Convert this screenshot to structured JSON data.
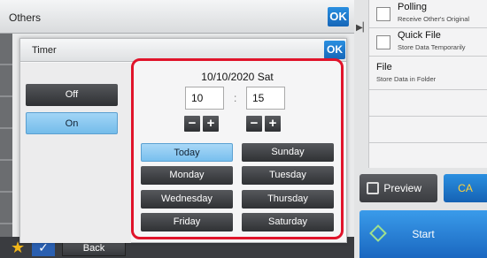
{
  "screen": {
    "title": "Others",
    "ok_label": "OK"
  },
  "right_panel": {
    "items": [
      {
        "title": "Polling",
        "subtitle": "Receive Other's Original"
      },
      {
        "title": "Quick File",
        "subtitle": "Store Data Temporarily"
      },
      {
        "title": "File",
        "subtitle": "Store Data in Folder"
      }
    ],
    "preview_label": "Preview",
    "ca_label": "CA",
    "start_label": "Start"
  },
  "bottom": {
    "back_label": "Back"
  },
  "dialog": {
    "title": "Timer",
    "ok_label": "OK",
    "off_label": "Off",
    "on_label": "On",
    "selected_option": "On",
    "date": "10/10/2020 Sat",
    "hour": "10",
    "minute": "15",
    "colon": ":",
    "minus": "−",
    "plus": "+",
    "days": [
      "Today",
      "Sunday",
      "Monday",
      "Tuesday",
      "Wednesday",
      "Thursday",
      "Friday",
      "Saturday"
    ],
    "selected_day": "Today"
  },
  "colors": {
    "accent_blue": "#1f7ad0",
    "highlight_red": "#e0142b",
    "selected_light_blue": "#8cc9f2"
  }
}
